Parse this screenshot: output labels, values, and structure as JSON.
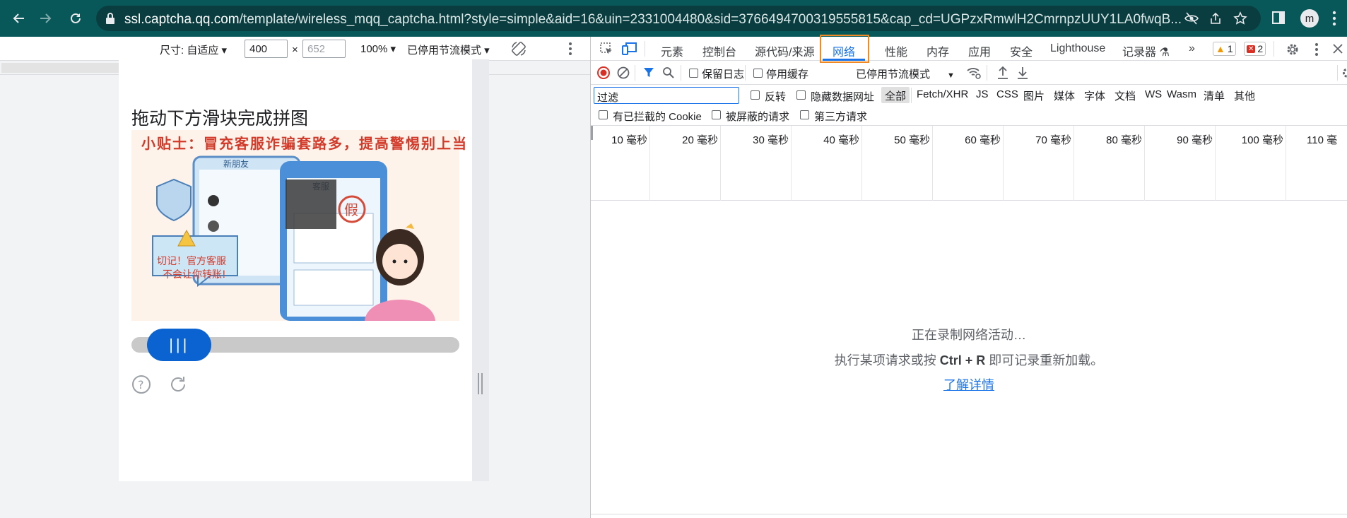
{
  "browser": {
    "url_host": "ssl.captcha.qq.com",
    "url_path": "/template/wireless_mqq_captcha.html?style=simple&aid=16&uin=2331004480&sid=3766494700319555815&cap_cd=UGPzxRmwlH2CmrnpzUUY1LA0fwqB...",
    "profile_initial": "m"
  },
  "devbar": {
    "size_label": "尺寸: 自适应",
    "width": "400",
    "times": "×",
    "height_placeholder": "652",
    "zoom": "100%",
    "throttle": "已停用节流模式"
  },
  "captcha": {
    "title": "拖动下方滑块完成拼图",
    "hint": "小贴士：冒充客服诈骗套路多，提高警惕别上当",
    "knob_label": "|||",
    "warning_line1": "切记！官方客服",
    "warning_line2": "不会让你转账!",
    "fake_stamp": "假",
    "group_title": "新朋友",
    "chat_title": "客服",
    "slider_position": 0.1
  },
  "devtools": {
    "tabs": [
      "元素",
      "控制台",
      "源代码/来源",
      "网络",
      "性能",
      "内存",
      "应用",
      "安全",
      "Lighthouse",
      "记录器"
    ],
    "active_tab": "网络",
    "warn_count": "1",
    "error_count": "2",
    "toolbar": {
      "preserve_log": "保留日志",
      "disable_cache": "停用缓存",
      "throttle": "已停用节流模式"
    },
    "filter_placeholder": "过滤",
    "filter_options": {
      "invert": "反转",
      "hide_data_urls": "隐藏数据网址"
    },
    "types": [
      "全部",
      "Fetch/XHR",
      "JS",
      "CSS",
      "图片",
      "媒体",
      "字体",
      "文档",
      "WS",
      "Wasm",
      "清单",
      "其他"
    ],
    "extra_filters": [
      "有已拦截的 Cookie",
      "被屏蔽的请求",
      "第三方请求"
    ],
    "timeline_ticks": [
      "10 毫秒",
      "20 毫秒",
      "30 毫秒",
      "40 毫秒",
      "50 毫秒",
      "60 毫秒",
      "70 毫秒",
      "80 毫秒",
      "90 毫秒",
      "100 毫秒",
      "110 毫"
    ],
    "empty": {
      "line1": "正在录制网络活动…",
      "line2_pre": "执行某项请求或按",
      "line2_key": "Ctrl + R",
      "line2_post": "即可记录重新加载。",
      "link": "了解详情"
    }
  }
}
